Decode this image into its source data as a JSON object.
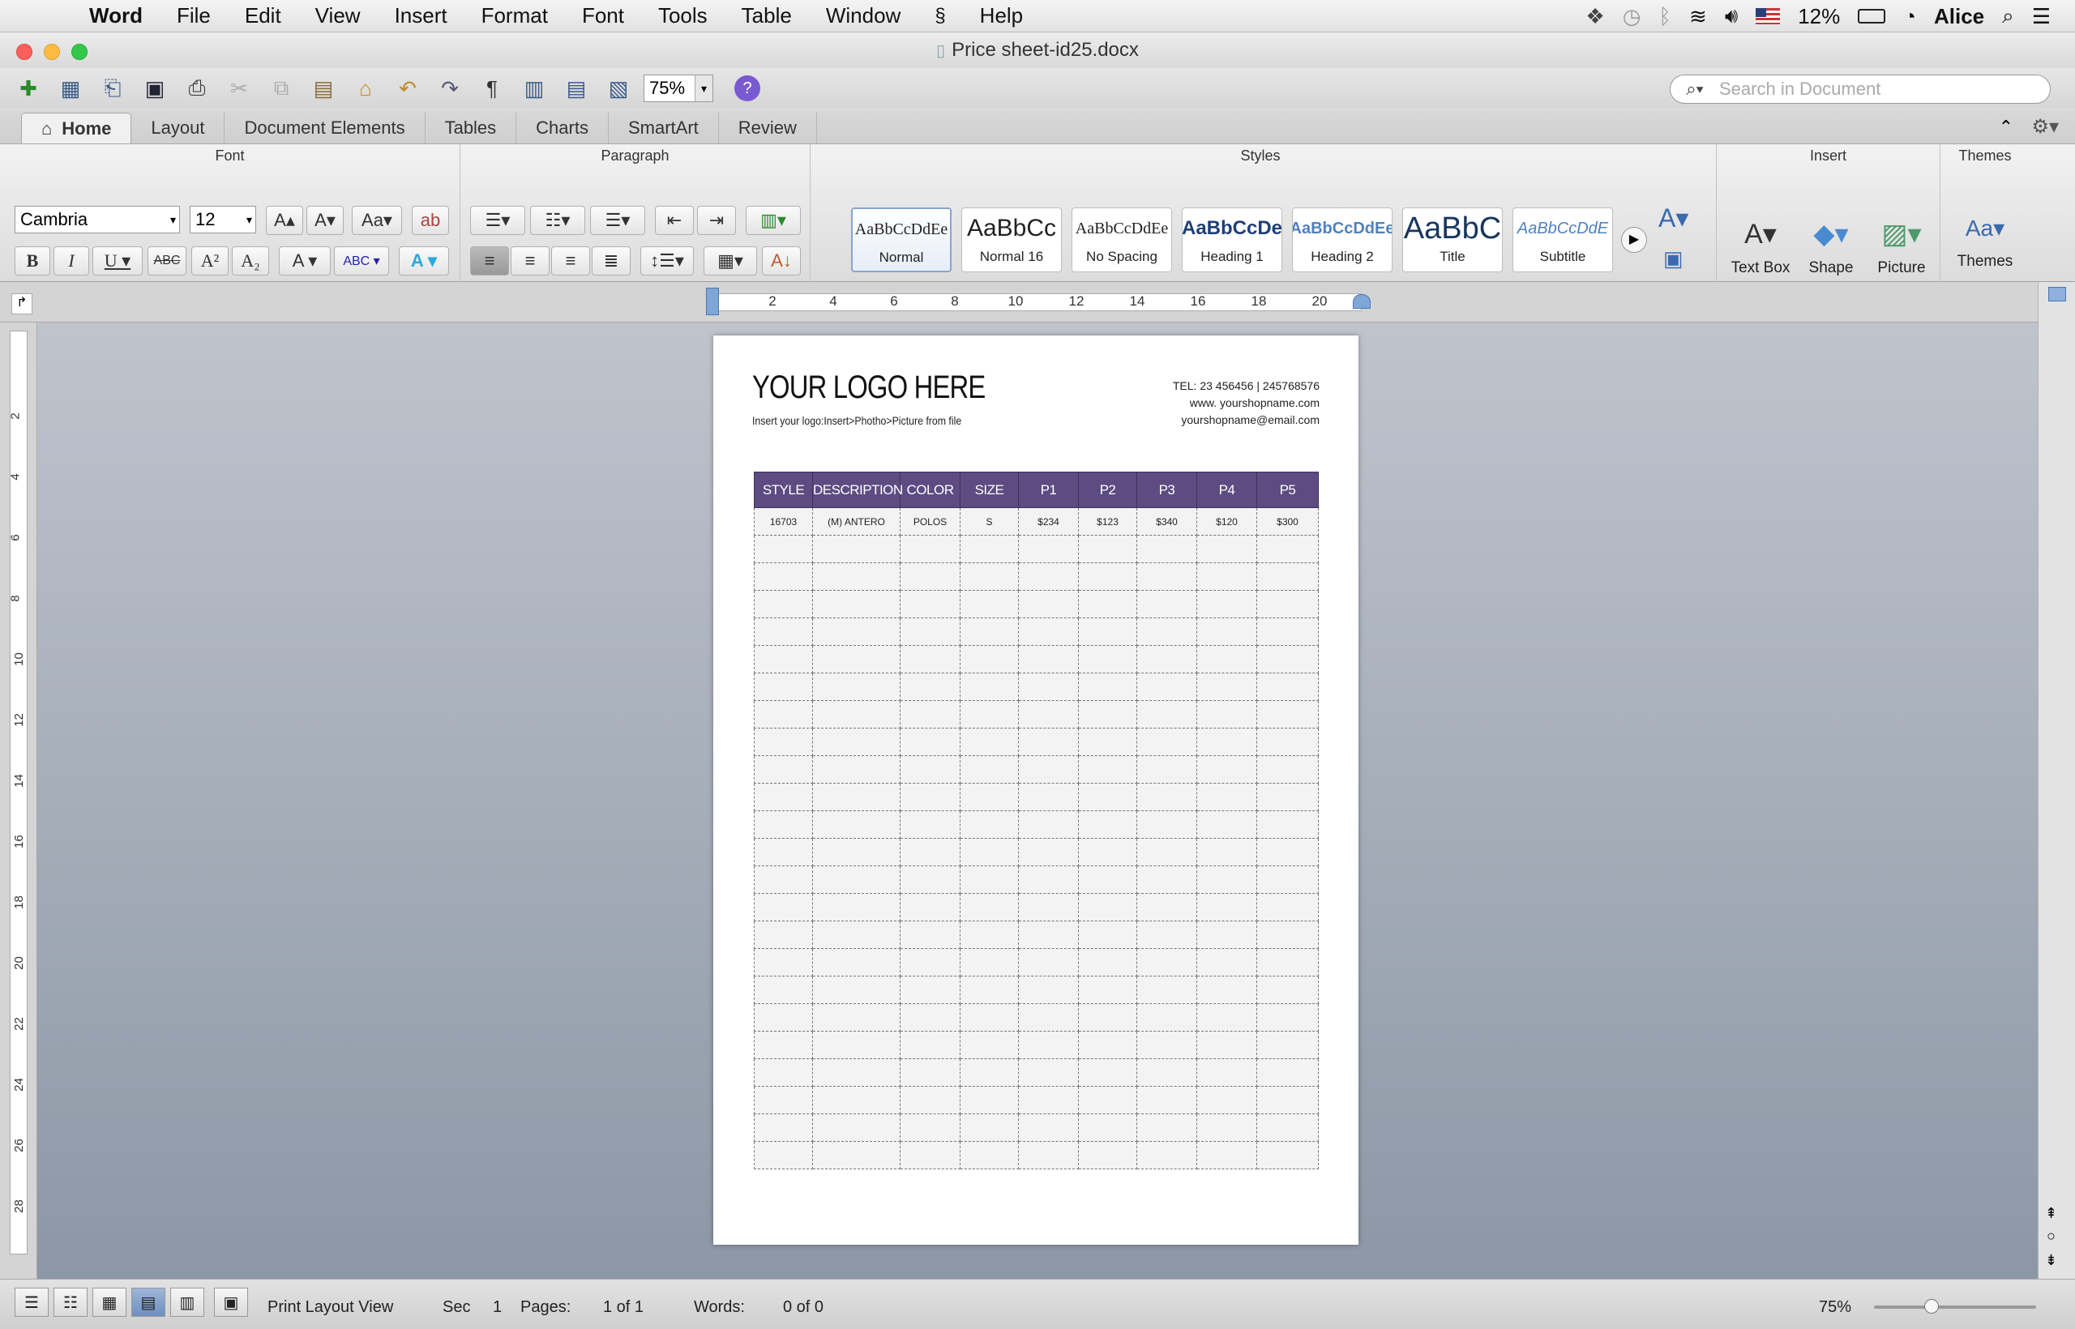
{
  "menubar": {
    "app": "Word",
    "items": [
      "File",
      "Edit",
      "View",
      "Insert",
      "Format",
      "Font",
      "Tools",
      "Table",
      "Window",
      "Help"
    ],
    "battery": "12%",
    "user": "Alice"
  },
  "window": {
    "title": "Price sheet-id25.docx"
  },
  "toolbar": {
    "zoom": "75%",
    "search_placeholder": "Search in Document"
  },
  "ribbon": {
    "tabs": [
      "Home",
      "Layout",
      "Document Elements",
      "Tables",
      "Charts",
      "SmartArt",
      "Review"
    ],
    "groups": {
      "font": "Font",
      "paragraph": "Paragraph",
      "styles": "Styles",
      "insert": "Insert",
      "themes": "Themes"
    },
    "font_name": "Cambria",
    "font_size": "12",
    "styles": [
      {
        "preview": "AaBbCcDdEe",
        "name": "Normal"
      },
      {
        "preview": "AaBbCc",
        "name": "Normal 16"
      },
      {
        "preview": "AaBbCcDdEe",
        "name": "No Spacing"
      },
      {
        "preview": "AaBbCcDe",
        "name": "Heading 1"
      },
      {
        "preview": "AaBbCcDdEe",
        "name": "Heading 2"
      },
      {
        "preview": "AaBbC",
        "name": "Title"
      },
      {
        "preview": "AaBbCcDdE",
        "name": "Subtitle"
      }
    ],
    "insert_buttons": {
      "text_box": "Text Box",
      "shape": "Shape",
      "picture": "Picture"
    },
    "themes_button": "Themes"
  },
  "ruler": {
    "marks": [
      "2",
      "4",
      "6",
      "8",
      "10",
      "12",
      "14",
      "16",
      "18",
      "20"
    ]
  },
  "vruler": {
    "marks": [
      "2",
      "4",
      "6",
      "8",
      "10",
      "12",
      "14",
      "16",
      "18",
      "20",
      "22",
      "24",
      "26",
      "28"
    ]
  },
  "document": {
    "logo": "YOUR LOGO HERE",
    "logo_hint": "Insert your logo:Insert>Photho>Picture from file",
    "tel": "TEL: 23 456456  |  245768576",
    "web": "www. yourshopname.com",
    "email": "yourshopname@email.com",
    "table": {
      "headers": [
        "STYLE",
        "DESCRIPTION",
        "COLOR",
        "SIZE",
        "P1",
        "P2",
        "P3",
        "P4",
        "P5"
      ],
      "rows": [
        [
          "16703",
          "(M) ANTERO",
          "POLOS",
          "S",
          "$234",
          "$123",
          "$340",
          "$120",
          "$300"
        ]
      ],
      "empty_rows": 23
    }
  },
  "status": {
    "view": "Print Layout View",
    "sec_label": "Sec",
    "sec_value": "1",
    "pages_label": "Pages:",
    "pages_value": "1 of 1",
    "words_label": "Words:",
    "words_value": "0 of 0",
    "zoom": "75%"
  }
}
